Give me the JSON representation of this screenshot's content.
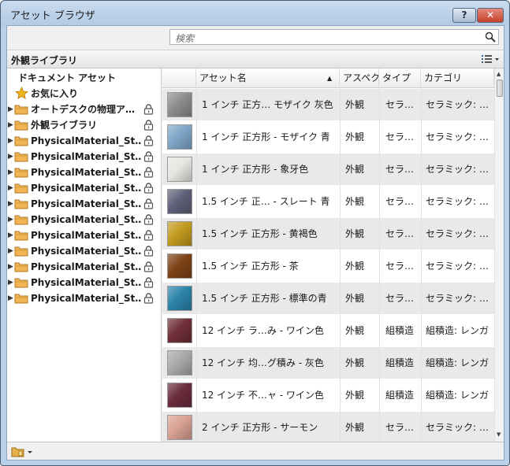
{
  "window": {
    "title": "アセット ブラウザ",
    "help_label": "?",
    "close_label": "✕"
  },
  "search": {
    "placeholder": "検索",
    "icon": "search-icon"
  },
  "library_bar": {
    "title": "外観ライブラリ",
    "view_icon": "list-view-icon"
  },
  "tree": {
    "header": "ドキュメント アセット",
    "items": [
      {
        "label": "お気に入り",
        "icon": "star-icon",
        "expander": "",
        "locked": false
      },
      {
        "label": "オートデスクの物理ア…",
        "icon": "folder-icon",
        "expander": "▶",
        "locked": true
      },
      {
        "label": "外観ライブラリ",
        "icon": "folder-icon",
        "expander": "▶",
        "locked": true
      },
      {
        "label": "PhysicalMaterial_St…",
        "icon": "folder-icon",
        "expander": "▶",
        "locked": true
      },
      {
        "label": "PhysicalMaterial_St…",
        "icon": "folder-icon",
        "expander": "▶",
        "locked": true
      },
      {
        "label": "PhysicalMaterial_St…",
        "icon": "folder-icon",
        "expander": "▶",
        "locked": true
      },
      {
        "label": "PhysicalMaterial_St…",
        "icon": "folder-icon",
        "expander": "▶",
        "locked": true
      },
      {
        "label": "PhysicalMaterial_St…",
        "icon": "folder-icon",
        "expander": "▶",
        "locked": true
      },
      {
        "label": "PhysicalMaterial_St…",
        "icon": "folder-icon",
        "expander": "▶",
        "locked": true
      },
      {
        "label": "PhysicalMaterial_St…",
        "icon": "folder-icon",
        "expander": "▶",
        "locked": true
      },
      {
        "label": "PhysicalMaterial_St…",
        "icon": "folder-icon",
        "expander": "▶",
        "locked": true
      },
      {
        "label": "PhysicalMaterial_St…",
        "icon": "folder-icon",
        "expander": "▶",
        "locked": true
      },
      {
        "label": "PhysicalMaterial_St…",
        "icon": "folder-icon",
        "expander": "▶",
        "locked": true
      },
      {
        "label": "PhysicalMaterial_St…",
        "icon": "folder-icon",
        "expander": "▶",
        "locked": true
      }
    ]
  },
  "table": {
    "columns": [
      "アセット名",
      "アスペク",
      "タイプ",
      "カテゴリ"
    ],
    "sort_indicator": "▲",
    "rows": [
      {
        "name": "1 インチ 正方… モザイク 灰色",
        "aspect": "外観",
        "type": "セラ…",
        "category": "セラミック: …",
        "swatch": "#8c8c8c"
      },
      {
        "name": "1 インチ 正方形 - モザイク 青",
        "aspect": "外観",
        "type": "セラ…",
        "category": "セラミック: …",
        "swatch": "#7fa6c8"
      },
      {
        "name": "1 インチ 正方形 - 象牙色",
        "aspect": "外観",
        "type": "セラ…",
        "category": "セラミック: …",
        "swatch": "#e6e6e2"
      },
      {
        "name": "1.5 インチ 正… - スレート 青",
        "aspect": "外観",
        "type": "セラ…",
        "category": "セラミック: …",
        "swatch": "#5e6078"
      },
      {
        "name": "1.5 インチ 正方形 - 黄褐色",
        "aspect": "外観",
        "type": "セラ…",
        "category": "セラミック: …",
        "swatch": "#c29a1e"
      },
      {
        "name": "1.5 インチ 正方形 - 茶",
        "aspect": "外観",
        "type": "セラ…",
        "category": "セラミック: …",
        "swatch": "#7d4216"
      },
      {
        "name": "1.5 インチ 正方形 - 標準の青",
        "aspect": "外観",
        "type": "セラ…",
        "category": "セラミック: …",
        "swatch": "#2a83a8"
      },
      {
        "name": "12 インチ ラ…み - ワイン色",
        "aspect": "外観",
        "type": "組積造",
        "category": "組積造: レンガ",
        "swatch": "#6e2e3a"
      },
      {
        "name": "12 インチ 均…グ積み - 灰色",
        "aspect": "外観",
        "type": "組積造",
        "category": "組積造: レンガ",
        "swatch": "#a8a8a8"
      },
      {
        "name": "12 インチ 不…ャ - ワイン色",
        "aspect": "外観",
        "type": "組積造",
        "category": "組積造: レンガ",
        "swatch": "#6a2c3c"
      },
      {
        "name": "2 インチ 正方形 - サーモン",
        "aspect": "外観",
        "type": "セラ…",
        "category": "セラミック: …",
        "swatch": "#d8a092"
      }
    ]
  },
  "bottom_bar": {
    "library_menu_icon": "library-menu-icon"
  }
}
